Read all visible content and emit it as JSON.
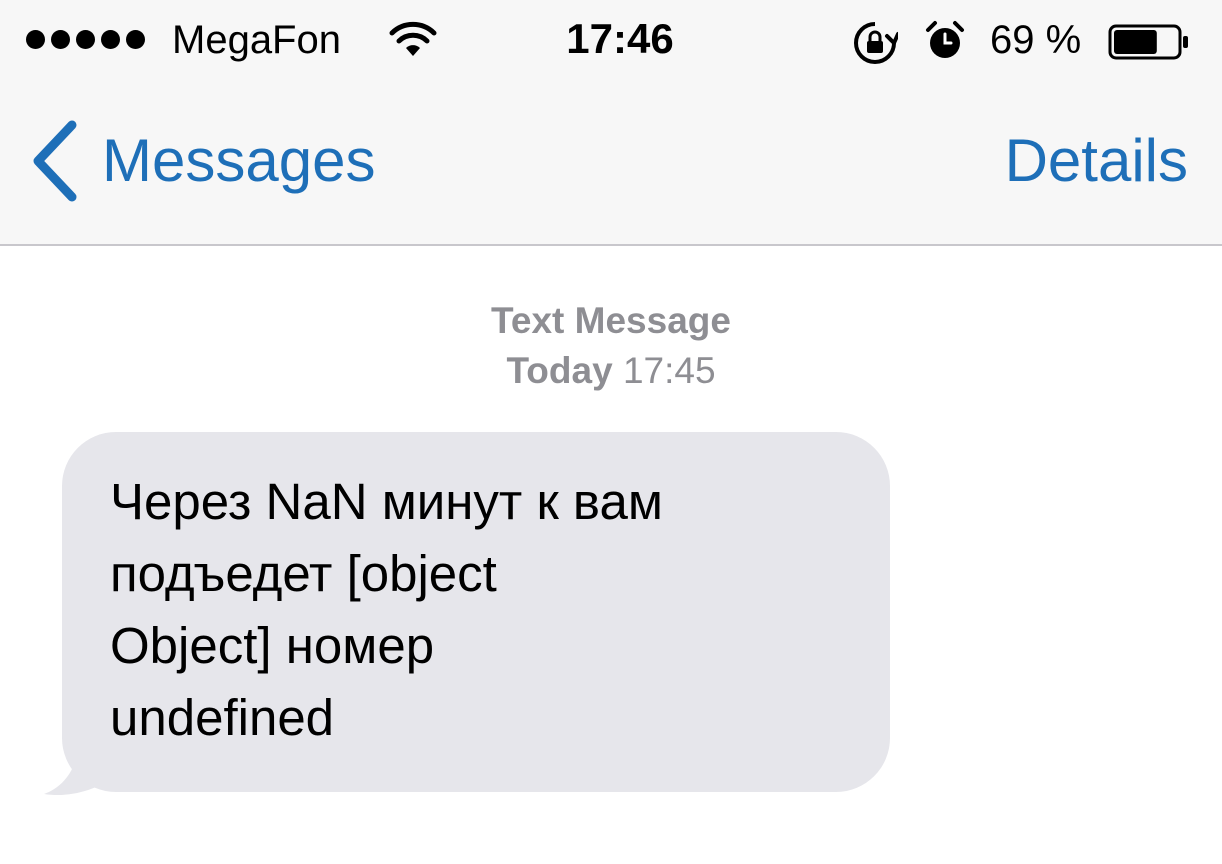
{
  "status_bar": {
    "signal_dots": 5,
    "carrier": "MegaFon",
    "time": "17:46",
    "battery_percent": "69 %",
    "battery_level": 0.69,
    "icons": [
      "signal-dots-icon",
      "wifi-icon",
      "rotation-lock-icon",
      "alarm-icon",
      "battery-icon"
    ]
  },
  "nav": {
    "back_label": "Messages",
    "details_label": "Details",
    "accent_color": "#1e6fb8"
  },
  "thread": {
    "kind": "Text Message",
    "day": "Today",
    "time": "17:45"
  },
  "messages": [
    {
      "direction": "incoming",
      "text": "Через NaN минут к вам\nподъедет [object\nObject] номер\nundefined",
      "bubble_color": "#e6e6eb"
    }
  ]
}
